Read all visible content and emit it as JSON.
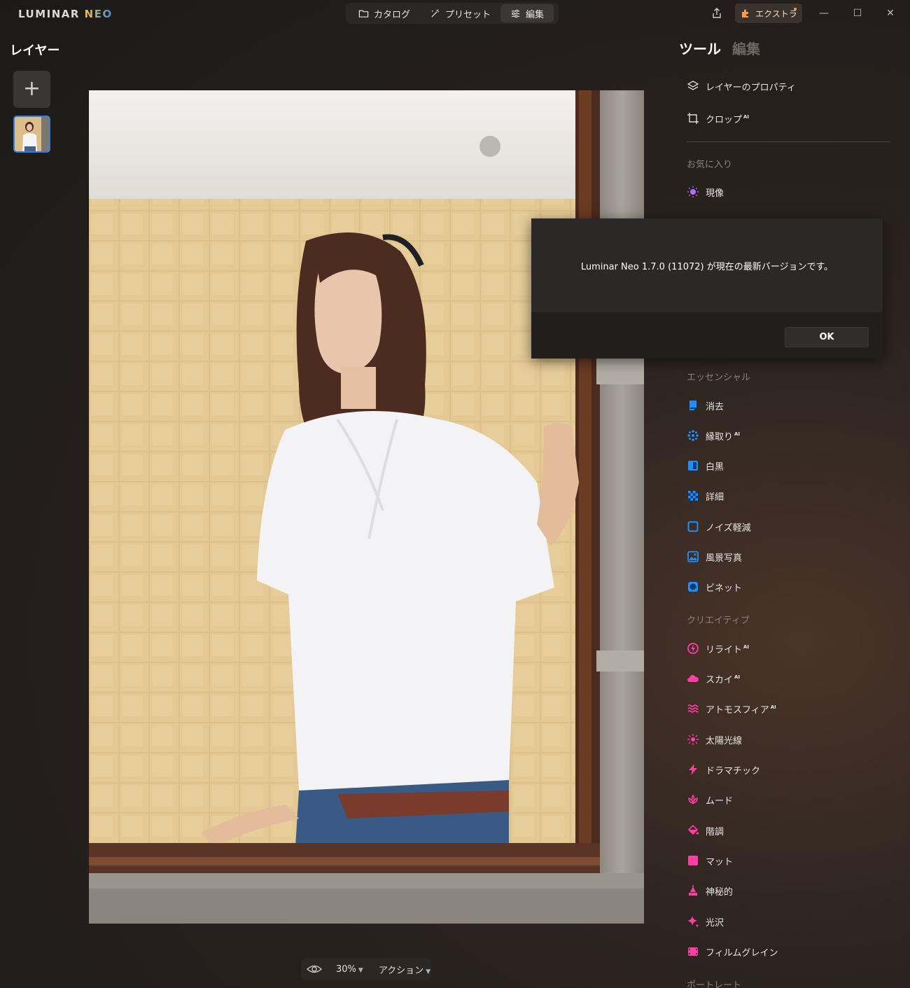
{
  "app": {
    "logo_main": "LUMINAR",
    "logo_neo": "NEO"
  },
  "modes": [
    {
      "label": "カタログ",
      "icon": "folder-icon"
    },
    {
      "label": "プリセット",
      "icon": "magic-wand-icon"
    },
    {
      "label": "編集",
      "icon": "sliders-icon",
      "active": true
    }
  ],
  "extras_label": "エクストラ",
  "layers": {
    "title": "レイヤー"
  },
  "tools_panel": {
    "tab_tools": "ツール",
    "tab_edit": "編集",
    "top_items": [
      {
        "label": "レイヤーのプロパティ",
        "icon": "layers-icon",
        "ai": false
      },
      {
        "label": "クロップ",
        "icon": "crop-icon",
        "ai": true
      }
    ],
    "ai_badge": "AI",
    "favorites": {
      "title": "お気に入り",
      "items": [
        {
          "label": "現像",
          "icon": "sun-icon"
        }
      ]
    },
    "essentials": {
      "title": "エッセンシャル",
      "items": [
        {
          "label": "消去",
          "icon": "eraser-icon",
          "ai": false
        },
        {
          "label": "縁取り",
          "icon": "dots-icon",
          "ai": true
        },
        {
          "label": "白黒",
          "icon": "bw-icon",
          "ai": false
        },
        {
          "label": "詳細",
          "icon": "detail-icon",
          "ai": false
        },
        {
          "label": "ノイズ軽減",
          "icon": "noise-icon",
          "ai": false
        },
        {
          "label": "風景写真",
          "icon": "landscape-icon",
          "ai": false
        },
        {
          "label": "ビネット",
          "icon": "vignette-icon",
          "ai": false
        }
      ]
    },
    "creative": {
      "title": "クリエイティブ",
      "items": [
        {
          "label": "リライト",
          "icon": "relight-icon",
          "ai": true
        },
        {
          "label": "スカイ",
          "icon": "cloud-icon",
          "ai": true
        },
        {
          "label": "アトモスフィア",
          "icon": "atmosphere-icon",
          "ai": true
        },
        {
          "label": "太陽光線",
          "icon": "sunrays-icon",
          "ai": false
        },
        {
          "label": "ドラマチック",
          "icon": "lightning-icon",
          "ai": false
        },
        {
          "label": "ムード",
          "icon": "lotus-icon",
          "ai": false
        },
        {
          "label": "階調",
          "icon": "bucket-icon",
          "ai": false
        },
        {
          "label": "マット",
          "icon": "square-icon",
          "ai": false
        },
        {
          "label": "神秘的",
          "icon": "mystic-icon",
          "ai": false
        },
        {
          "label": "光沢",
          "icon": "sparkle-icon",
          "ai": false
        },
        {
          "label": "フィルムグレイン",
          "icon": "film-icon",
          "ai": false
        }
      ]
    },
    "portrait": {
      "title": "ポートレート"
    }
  },
  "bottom_bar": {
    "zoom": "30%",
    "action": "アクション"
  },
  "dialog": {
    "message": "Luminar Neo 1.7.0 (11072) が現在の最新バージョンです。",
    "ok": "OK"
  },
  "colors": {
    "accent_blue": "#2f7fe0",
    "essential_icon": "#1e8fff",
    "creative_icon": "#ff3ea5",
    "favorite_icon": "#b66cff"
  }
}
